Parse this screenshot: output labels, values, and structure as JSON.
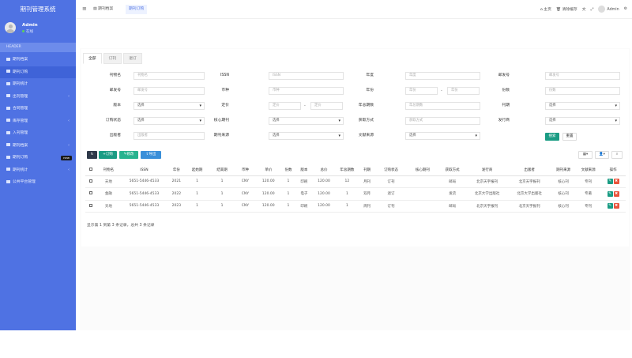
{
  "sidebar": {
    "title": "期刊管理系统",
    "user": {
      "name": "Admin",
      "status": "在线"
    },
    "nav_header": "HEADER",
    "items": [
      {
        "label": "期刊档案",
        "arrow": ""
      },
      {
        "label": "期刊订购",
        "arrow": ""
      },
      {
        "label": "期刊统计",
        "arrow": ""
      },
      {
        "label": "出刊管理",
        "arrow": "‹"
      },
      {
        "label": "合同管理",
        "arrow": ""
      },
      {
        "label": "库存管理",
        "arrow": "‹"
      },
      {
        "label": "入刊管理",
        "arrow": ""
      },
      {
        "label": "期刊档案",
        "arrow": "‹"
      },
      {
        "label": "期刊订购",
        "badge": "new"
      },
      {
        "label": "期刊统计",
        "arrow": "‹"
      },
      {
        "label": "公共平台管理",
        "arrow": ""
      }
    ]
  },
  "topbar": {
    "menu_icon": "≡",
    "tabs": [
      "期刊档案",
      "期刊订购"
    ],
    "right": {
      "home": "主页",
      "clear_cache": "清除缓存",
      "user": "Admin"
    }
  },
  "tabs": [
    "全部",
    "订刊",
    "退订"
  ],
  "form": {
    "rows": [
      [
        {
          "label": "刊物名",
          "kind": "input",
          "value": "刊物名"
        },
        {
          "label": "ISSN",
          "kind": "input",
          "value": "ISSN"
        },
        {
          "label": "年度",
          "kind": "input",
          "value": "年度"
        },
        {
          "label": "邮发号",
          "kind": "input",
          "value": "邮发号"
        }
      ],
      [
        {
          "label": "邮发号",
          "kind": "input",
          "value": "邮发号"
        },
        {
          "label": "币种",
          "kind": "input",
          "value": "币种"
        },
        {
          "label": "年份",
          "kind": "range",
          "from": "年份",
          "to": "年份"
        },
        {
          "label": "份数",
          "kind": "input",
          "value": "份数"
        }
      ],
      [
        {
          "label": "版本",
          "kind": "select",
          "value": "选择"
        },
        {
          "label": "定价",
          "kind": "range",
          "from": "定价",
          "to": "定价"
        },
        {
          "label": "年总期数",
          "kind": "input",
          "value": "年总期数"
        },
        {
          "label": "刊期",
          "kind": "select",
          "value": "选择"
        }
      ],
      [
        {
          "label": "订购状态",
          "kind": "select",
          "value": "选择"
        },
        {
          "label": "核心期刊",
          "kind": "select",
          "value": "选择"
        },
        {
          "label": "获取方式",
          "kind": "input",
          "value": "获取方式"
        },
        {
          "label": "发行商",
          "kind": "select",
          "value": "选择"
        }
      ],
      [
        {
          "label": "出版者",
          "kind": "input",
          "value": "出版者"
        },
        {
          "label": "期刊来源",
          "kind": "select",
          "value": "选择"
        },
        {
          "label": "文献来源",
          "kind": "select",
          "value": "选择"
        }
      ]
    ],
    "search": "搜索",
    "reset": "重置"
  },
  "toolbar": {
    "refresh": "↻",
    "add": "+订购",
    "edit": "✎修改",
    "export": "⇪导出",
    "view": "▦▾",
    "user": "👤▾",
    "search": "⌕"
  },
  "table": {
    "headers": [
      "",
      "刊物名",
      "ISSN",
      "年份",
      "起始期",
      "结束期",
      "币种",
      "单价",
      "份数",
      "版本",
      "总价",
      "年总期数",
      "刊期",
      "订购状态",
      "核心期刊",
      "获取方式",
      "发行商",
      "出版者",
      "期刊来源",
      "文献来源",
      "操作"
    ],
    "rows": [
      [
        "",
        "天地",
        "5651-5446-4533",
        "2021",
        "1",
        "1",
        "CNY",
        "120.00",
        "1",
        "印刷",
        "120.00",
        "12",
        "月刊",
        "订刊",
        "",
        "邮局",
        "北京天宇报刊",
        "北京天宇报刊",
        "核心刊",
        "专刊",
        ""
      ],
      [
        "",
        "金融",
        "5651-5446-4533",
        "2022",
        "1",
        "1",
        "CNY",
        "120.00",
        "1",
        "电子",
        "120.00",
        "1",
        "双月",
        "退订",
        "",
        "发货",
        "北京大学出版社",
        "北京大学出版社",
        "核心刊",
        "专著",
        ""
      ],
      [
        "",
        "天地",
        "5651-5446-4533",
        "2023",
        "1",
        "1",
        "CNY",
        "120.00",
        "1",
        "印刷",
        "120.00",
        "1",
        "周刊",
        "订刊",
        "",
        "邮局",
        "北京天宇报刊",
        "北京天宇报刊",
        "核心刊",
        "专刊",
        ""
      ]
    ],
    "summary": "显示第 1 到第 3 条记录，总共 3 条记录"
  }
}
